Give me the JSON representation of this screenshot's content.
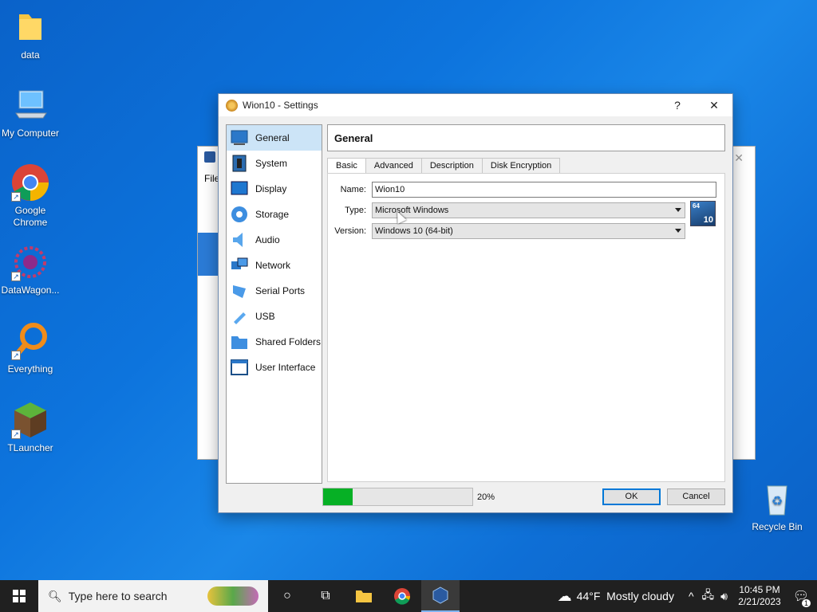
{
  "desktop": {
    "icons": [
      {
        "label": "data",
        "icon": "folder-icon"
      },
      {
        "label": "My Computer",
        "icon": "computer-icon"
      },
      {
        "label": "Google Chrome",
        "icon": "chrome-icon"
      },
      {
        "label": "DataWagon...",
        "icon": "datawagon-icon"
      },
      {
        "label": "Everything",
        "icon": "everything-search-icon"
      },
      {
        "label": "TLauncher",
        "icon": "minecraft-block-icon"
      },
      {
        "label": "Recycle Bin",
        "icon": "recycle-bin-icon"
      }
    ]
  },
  "background_window": {
    "menu_file": "File"
  },
  "dialog": {
    "title": "Wion10 - Settings",
    "help": "?",
    "close": "✕",
    "sidebar": [
      {
        "label": "General",
        "icon": "general-icon",
        "active": true
      },
      {
        "label": "System",
        "icon": "chip-icon"
      },
      {
        "label": "Display",
        "icon": "monitor-icon"
      },
      {
        "label": "Storage",
        "icon": "disk-icon"
      },
      {
        "label": "Audio",
        "icon": "speaker-icon"
      },
      {
        "label": "Network",
        "icon": "network-icon"
      },
      {
        "label": "Serial Ports",
        "icon": "serial-port-icon"
      },
      {
        "label": "USB",
        "icon": "usb-icon"
      },
      {
        "label": "Shared Folders",
        "icon": "folder-icon"
      },
      {
        "label": "User Interface",
        "icon": "window-icon"
      }
    ],
    "header": "General",
    "tabs": [
      "Basic",
      "Advanced",
      "Description",
      "Disk Encryption"
    ],
    "active_tab": "Basic",
    "fields": {
      "name_label": "Name:",
      "name_value": "Wion10",
      "type_label": "Type:",
      "type_value": "Microsoft Windows",
      "version_label": "Version:",
      "version_value": "Windows 10 (64-bit)",
      "os_badge_top": "64",
      "os_badge_bottom": "10"
    },
    "progress": {
      "value": 0.2,
      "label": "20%"
    },
    "ok_label": "OK",
    "cancel_label": "Cancel"
  },
  "taskbar": {
    "search_placeholder": "Type here to search",
    "weather": "44°F  Mostly cloudy",
    "time": "10:45 PM",
    "date": "2/21/2023",
    "notification_count": "1"
  }
}
